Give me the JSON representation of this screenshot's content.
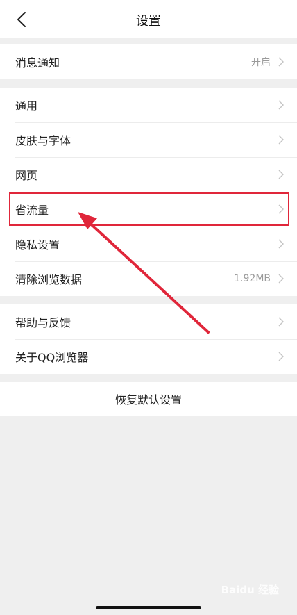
{
  "header": {
    "title": "设置"
  },
  "groups": [
    {
      "items": [
        {
          "label": "消息通知",
          "value": "开启"
        }
      ]
    },
    {
      "items": [
        {
          "label": "通用",
          "value": ""
        },
        {
          "label": "皮肤与字体",
          "value": ""
        },
        {
          "label": "网页",
          "value": ""
        },
        {
          "label": "省流量",
          "value": ""
        },
        {
          "label": "隐私设置",
          "value": ""
        },
        {
          "label": "清除浏览数据",
          "value": "1.92MB"
        }
      ]
    },
    {
      "items": [
        {
          "label": "帮助与反馈",
          "value": ""
        },
        {
          "label": "关于QQ浏览器",
          "value": ""
        }
      ]
    }
  ],
  "reset_label": "恢复默认设置",
  "annotation": {
    "color": "#e0263a"
  },
  "icons": {
    "back": "back-chevron-icon",
    "row": "chevron-right-icon"
  },
  "watermark": "Baidu 经验"
}
